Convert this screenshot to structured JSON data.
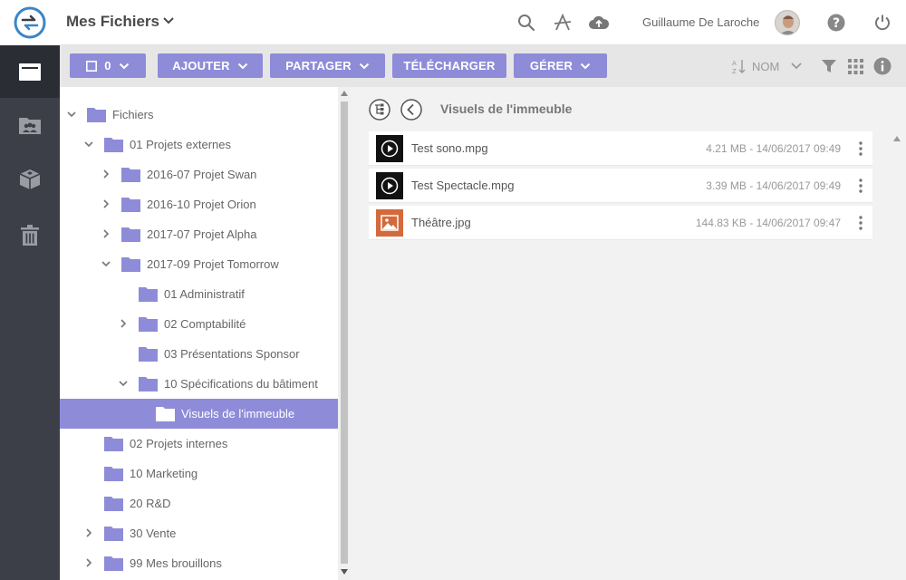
{
  "header": {
    "title": "Mes Fichiers",
    "user_name": "Guillaume De Laroche"
  },
  "toolbar": {
    "select_count": "0",
    "add_label": "AJOUTER",
    "share_label": "PARTAGER",
    "download_label": "TÉLÉCHARGER",
    "manage_label": "GÉRER",
    "sort_label": "NOM"
  },
  "tree": {
    "items": [
      {
        "label": "Fichiers"
      },
      {
        "label": "01 Projets externes"
      },
      {
        "label": "2016-07 Projet Swan"
      },
      {
        "label": "2016-10 Projet Orion"
      },
      {
        "label": "2017-07 Projet Alpha"
      },
      {
        "label": "2017-09 Projet Tomorrow"
      },
      {
        "label": "01 Administratif"
      },
      {
        "label": "02 Comptabilité"
      },
      {
        "label": "03 Présentations Sponsor"
      },
      {
        "label": "10 Spécifications du bâtiment"
      },
      {
        "label": "Visuels de l'immeuble"
      },
      {
        "label": "02 Projets internes"
      },
      {
        "label": "10 Marketing"
      },
      {
        "label": "20 R&D"
      },
      {
        "label": "30 Vente"
      },
      {
        "label": "99 Mes brouillons"
      }
    ]
  },
  "content": {
    "folder_title": "Visuels de l'immeuble",
    "files": [
      {
        "name": "Test sono.mpg",
        "meta": "4.21 MB - 14/06/2017 09:49"
      },
      {
        "name": "Test Spectacle.mpg",
        "meta": "3.39 MB - 14/06/2017 09:49"
      },
      {
        "name": "Théâtre.jpg",
        "meta": "144.83 KB - 14/06/2017 09:47"
      }
    ]
  },
  "colors": {
    "accent": "#8e8cd8",
    "rail": "#3c3e48",
    "image_thumb": "#d4693b"
  }
}
